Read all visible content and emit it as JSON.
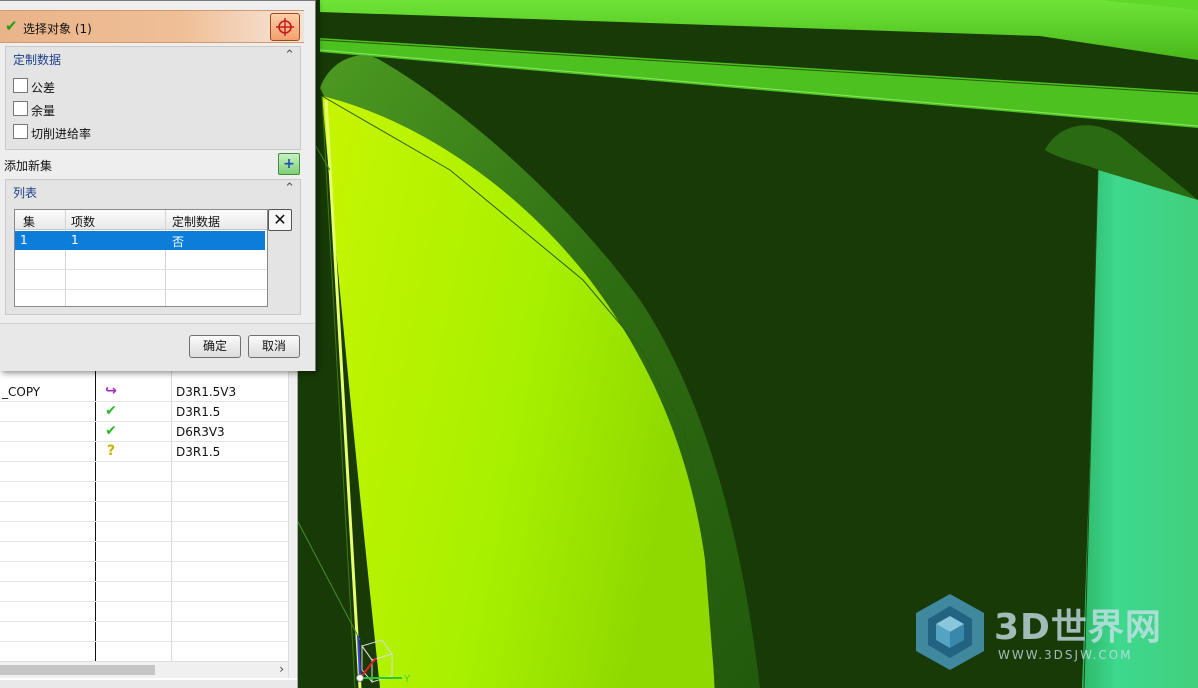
{
  "dialog": {
    "select_object_label": "选择对象 (1)",
    "custom_data_section": {
      "title": "定制数据",
      "checkboxes": [
        {
          "label": "公差",
          "checked": false
        },
        {
          "label": "余量",
          "checked": false
        },
        {
          "label": "切削进给率",
          "checked": false
        }
      ]
    },
    "add_set_label": "添加新集",
    "list_section": {
      "title": "列表",
      "columns": [
        "集",
        "项数",
        "定制数据"
      ],
      "rows": [
        {
          "set": "1",
          "count": "1",
          "custom": "否",
          "selected": true
        }
      ]
    },
    "ok_label": "确定",
    "cancel_label": "取消"
  },
  "navigator": {
    "rows": [
      {
        "name": "_COPY",
        "status_icon": "purple-redo-arrow-icon",
        "tool": "D3R1.5V3"
      },
      {
        "name": "",
        "status_icon": "green-check-icon",
        "tool": "D3R1.5"
      },
      {
        "name": "",
        "status_icon": "green-check-icon",
        "tool": "D6R3V3"
      },
      {
        "name": "",
        "status_icon": "yellow-question-icon",
        "tool": "D3R1.5"
      }
    ]
  },
  "triad": {
    "y_label": "Y"
  },
  "watermark": {
    "text": "3D世界网",
    "url": "WWW.3DSJW.COM"
  },
  "colors": {
    "viewport_background": "#173a06",
    "surface_yellow_green": "#b0f200",
    "surface_green": "#5fd827",
    "surface_teal": "#3ad88a",
    "select_header": "#eab48a",
    "selected_row": "#0c7ed9"
  }
}
